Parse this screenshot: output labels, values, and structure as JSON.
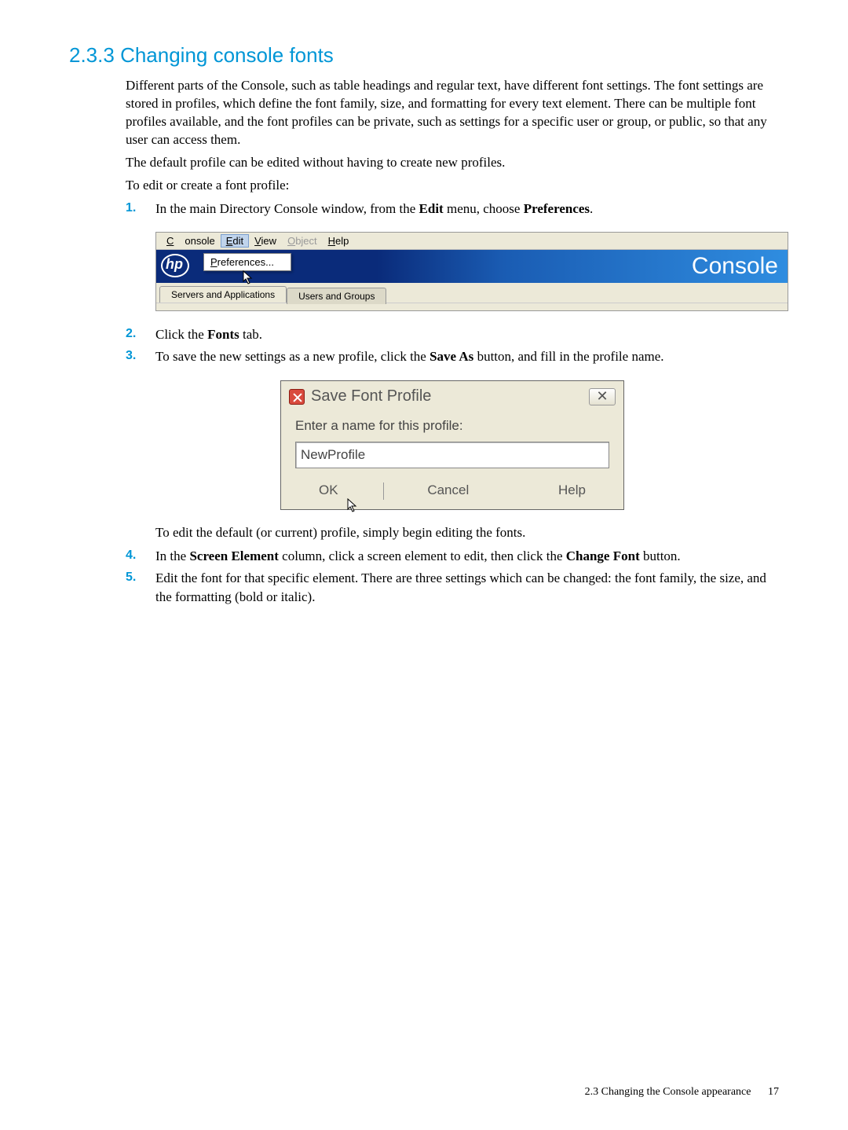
{
  "section": {
    "number": "2.3.3",
    "title": "Changing console fonts"
  },
  "paragraphs": {
    "p1": "Different parts of the Console, such as table headings and regular text, have different font settings. The font settings are stored in profiles, which define the font family, size, and formatting for every text element. There can be multiple font profiles available, and the font profiles can be private, such as settings for a specific user or group, or public, so that any user can access them.",
    "p2": "The default profile can be edited without having to create new profiles.",
    "p3": "To edit or create a font profile:",
    "edit_default": "To edit the default (or current) profile, simply begin editing the fonts."
  },
  "steps": {
    "s1_a": "In the main Directory Console window, from the ",
    "s1_b": "Edit",
    "s1_c": " menu, choose ",
    "s1_d": "Preferences",
    "s1_e": ".",
    "s2_a": "Click the ",
    "s2_b": "Fonts",
    "s2_c": " tab.",
    "s3_a": "To save the new settings as a new profile, click the ",
    "s3_b": "Save As",
    "s3_c": " button, and fill in the profile name.",
    "s4_a": "In the ",
    "s4_b": "Screen Element",
    "s4_c": " column, click a screen element to edit, then click the ",
    "s4_d": "Change Font",
    "s4_e": " button.",
    "s5": "Edit the font for that specific element. There are three settings which can be changed: the font family, the size, and the formatting (bold or italic).",
    "nums": {
      "n1": "1.",
      "n2": "2.",
      "n3": "3.",
      "n4": "4.",
      "n5": "5."
    }
  },
  "console_fig": {
    "menu": {
      "console": "Console",
      "edit": "Edit",
      "view": "View",
      "object": "Object",
      "help": "Help"
    },
    "dropdown_item": "Preferences...",
    "label": "Console",
    "tab1": "Servers and Applications",
    "tab2": "Users and Groups",
    "hp": "hp"
  },
  "dialog": {
    "title": "Save Font Profile",
    "close_glyph": "✕",
    "prompt": "Enter a name for this profile:",
    "value": "NewProfile",
    "ok": "OK",
    "cancel": "Cancel",
    "help": "Help"
  },
  "footer": {
    "text": "2.3 Changing the Console appearance",
    "page": "17"
  }
}
